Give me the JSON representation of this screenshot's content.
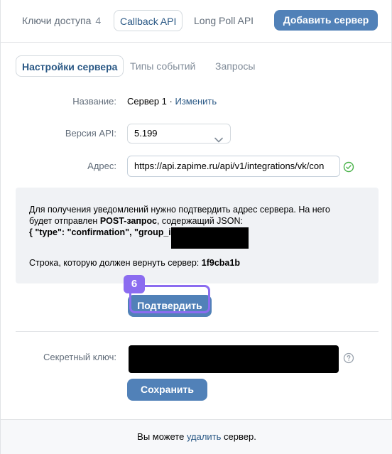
{
  "top_tabs": {
    "access_keys": "Ключи доступа",
    "access_keys_count": "4",
    "callback_api": "Callback API",
    "long_poll_api": "Long Poll API",
    "add_server": "Добавить сервер"
  },
  "sub_tabs": {
    "server_settings": "Настройки сервера",
    "event_types": "Типы событий",
    "requests": "Запросы"
  },
  "form": {
    "name_label": "Название:",
    "name_value": "Сервер 1",
    "name_separator": " · ",
    "name_change": "Изменить",
    "api_version_label": "Версия API:",
    "api_version_value": "5.199",
    "address_label": "Адрес:",
    "address_value": "https://api.zapime.ru/api/v1/integrations/vk/con"
  },
  "info": {
    "line1": "Для получения уведомлений нужно подтвердить адрес сервера. На него",
    "line2_prefix": "будет отправлен ",
    "line2_bold": "POST-запрос",
    "line2_suffix": ", содержащий JSON:",
    "json_text": "{ \"type\": \"confirmation\", \"group_id\":",
    "return_prefix": "Строка, которую должен вернуть сервер: ",
    "return_code": "1f9cba1b"
  },
  "confirm": {
    "badge": "6",
    "label": "Подтвердить"
  },
  "secret": {
    "label": "Секретный ключ:",
    "save": "Сохранить"
  },
  "footer": {
    "prefix": "Вы можете ",
    "link": "удалить",
    "suffix": " сервер."
  },
  "colors": {
    "accent": "#5181b8",
    "link": "#2a5885",
    "highlight": "#8b6cf0",
    "ok": "#4bb34b"
  },
  "icons": {
    "select": "chevron-down-icon",
    "address_status": "check-circle-icon",
    "secret_help": "question-circle-icon"
  }
}
